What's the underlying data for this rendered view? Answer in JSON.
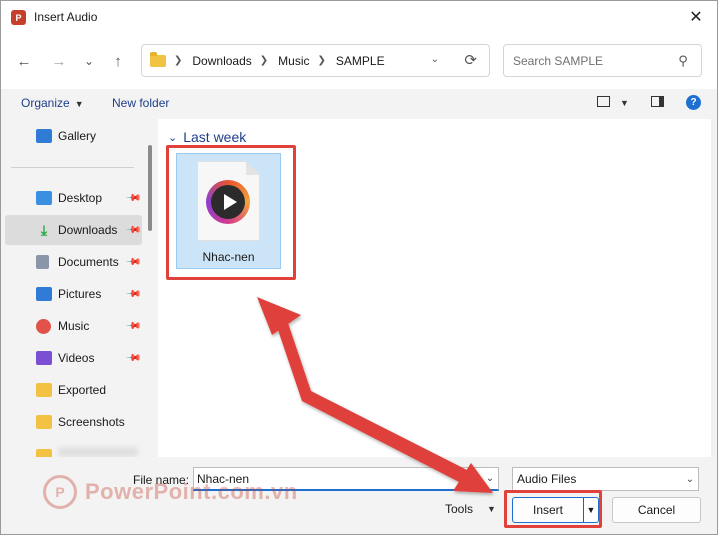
{
  "window": {
    "title": "Insert Audio",
    "app_icon": "powerpoint-icon",
    "close_icon": "✕"
  },
  "nav": {
    "back_icon": "←",
    "forward_icon": "→",
    "recent_icon": "⌄",
    "up_icon": "↑",
    "breadcrumbs": [
      "Downloads",
      "Music",
      "SAMPLE"
    ],
    "refresh_icon": "⟳",
    "search_placeholder": "Search SAMPLE"
  },
  "toolbar": {
    "organize": "Organize",
    "new_folder": "New folder",
    "help": "?"
  },
  "sidebar": {
    "items": [
      {
        "label": "Gallery",
        "icon": "gallery-icon",
        "color": "#2f7bd6",
        "pinned": false
      },
      {
        "label": "Desktop",
        "icon": "desktop-icon",
        "color": "#3b8fe0",
        "pinned": true
      },
      {
        "label": "Downloads",
        "icon": "download-icon",
        "color": "#27a844",
        "pinned": true,
        "selected": true
      },
      {
        "label": "Documents",
        "icon": "document-icon",
        "color": "#8a96a8",
        "pinned": true
      },
      {
        "label": "Pictures",
        "icon": "pictures-icon",
        "color": "#2f7bd6",
        "pinned": true
      },
      {
        "label": "Music",
        "icon": "music-icon",
        "color": "#e0524a",
        "pinned": true
      },
      {
        "label": "Videos",
        "icon": "videos-icon",
        "color": "#7b4fd1",
        "pinned": true
      },
      {
        "label": "Exported",
        "icon": "folder-icon",
        "color": "#f2c343",
        "pinned": false
      },
      {
        "label": "Screenshots",
        "icon": "folder-icon",
        "color": "#f2c343",
        "pinned": false
      }
    ]
  },
  "main": {
    "group_label": "Last week",
    "files": [
      {
        "name": "Nhac-nen",
        "icon": "audio-file-icon"
      }
    ]
  },
  "bottom": {
    "file_name_label": "File name:",
    "file_name_value": "Nhac-nen",
    "file_type": "Audio Files",
    "tools": "Tools",
    "insert": "Insert",
    "cancel": "Cancel"
  },
  "watermark": {
    "text": "PowerPoint.com.vn"
  },
  "colors": {
    "accent": "#1f6fd1",
    "annotation": "#e0413a",
    "selection": "#cce4f7"
  }
}
